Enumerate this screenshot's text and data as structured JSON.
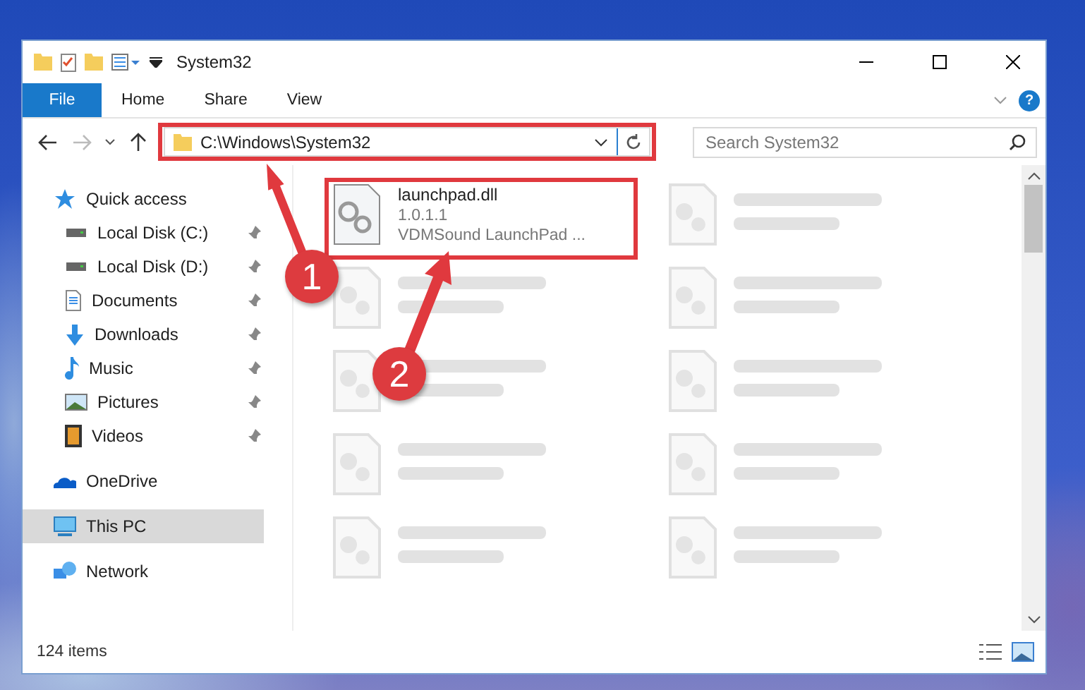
{
  "window": {
    "title": "System32"
  },
  "ribbon_tabs": [
    {
      "label": "File",
      "selected": true
    },
    {
      "label": "Home",
      "selected": false
    },
    {
      "label": "Share",
      "selected": false
    },
    {
      "label": "View",
      "selected": false
    }
  ],
  "help": "?",
  "address": {
    "path": "C:\\Windows\\System32",
    "highlighted": true
  },
  "search": {
    "placeholder": "Search System32"
  },
  "sidebar": {
    "items": [
      {
        "label": "Quick access",
        "kind": "star",
        "selected": false,
        "children": [
          {
            "label": "Local Disk (C:)",
            "kind": "drive",
            "pinned": true
          },
          {
            "label": "Local Disk (D:)",
            "kind": "drive",
            "pinned": true
          },
          {
            "label": "Documents",
            "kind": "document",
            "pinned": true
          },
          {
            "label": "Downloads",
            "kind": "download",
            "pinned": true
          },
          {
            "label": "Music",
            "kind": "music",
            "pinned": true
          },
          {
            "label": "Pictures",
            "kind": "pictures",
            "pinned": true
          },
          {
            "label": "Videos",
            "kind": "video",
            "pinned": true
          }
        ]
      },
      {
        "label": "OneDrive",
        "kind": "cloud",
        "selected": false
      },
      {
        "label": "This PC",
        "kind": "computer",
        "selected": true
      },
      {
        "label": "Network",
        "kind": "network",
        "selected": false
      }
    ]
  },
  "files": [
    {
      "kind": "file",
      "name": "launchpad.dll",
      "lines": [
        "1.0.1.1",
        "VDMSound LaunchPad ..."
      ],
      "highlighted": true
    },
    {
      "kind": "blurred"
    },
    {
      "kind": "blurred"
    },
    {
      "kind": "blurred"
    },
    {
      "kind": "blurred"
    },
    {
      "kind": "blurred"
    },
    {
      "kind": "blurred"
    },
    {
      "kind": "blurred"
    },
    {
      "kind": "blurred"
    },
    {
      "kind": "blurred"
    }
  ],
  "status_bar": {
    "count": "124 items"
  },
  "annotations": [
    {
      "number": "1"
    },
    {
      "number": "2"
    }
  ]
}
